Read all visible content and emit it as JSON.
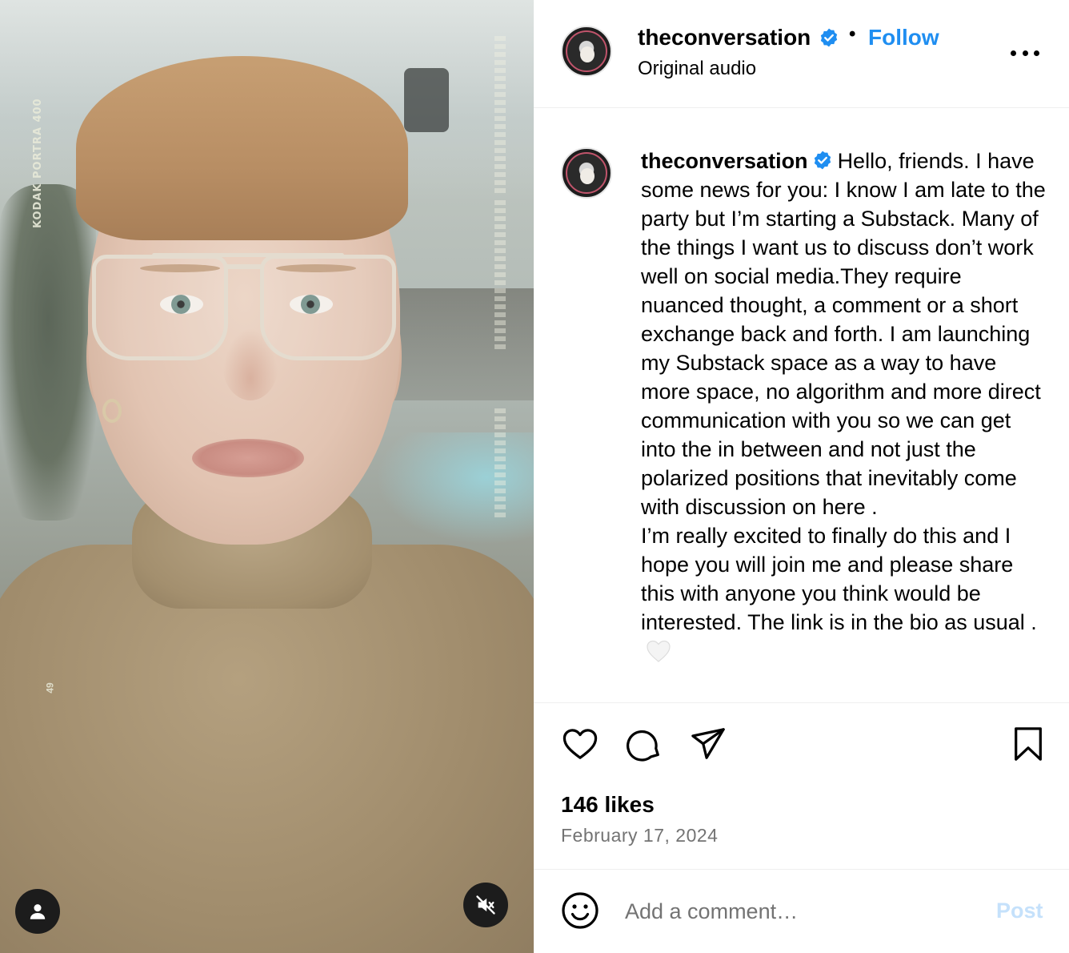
{
  "post": {
    "media": {
      "film_label": "KODAK PORTRA 400",
      "film_frame": "49",
      "user_icon": "user-tag-icon",
      "mute_icon": "speaker-muted-icon"
    },
    "header": {
      "username": "theconversation",
      "verified": true,
      "separator": "•",
      "follow_label": "Follow",
      "audio_label": "Original audio",
      "more_icon": "more-options-icon"
    },
    "caption": {
      "username": "theconversation",
      "text": "Hello, friends. I have some news for you: I know I am late to the party but I’m starting a Substack. Many of the things I want us to discuss don’t work well on social media.They require nuanced thought, a comment or a short exchange back and forth. I am launching my Substack space as a way to have more space, no algorithm and more direct communication with you so we can get into the in between and not just the polarized positions that inevitably come with discussion on here .\nI’m really excited to finally do this and I hope you will join me and please share this with anyone you think would be interested. The link is in the bio as usual .",
      "emoji": "white-heart"
    },
    "actions": {
      "icons": [
        "heart-icon",
        "comment-icon",
        "share-icon",
        "bookmark-icon"
      ],
      "likes": "146 likes",
      "date": "February 17, 2024"
    },
    "comment_bar": {
      "emoji_icon": "smiley-icon",
      "placeholder": "Add a comment…",
      "post_label": "Post"
    },
    "colors": {
      "follow": "#1f8ef1",
      "verified": "#1f8ef1",
      "post_disabled": "#c5e1fb",
      "muted_text": "#737373"
    }
  }
}
